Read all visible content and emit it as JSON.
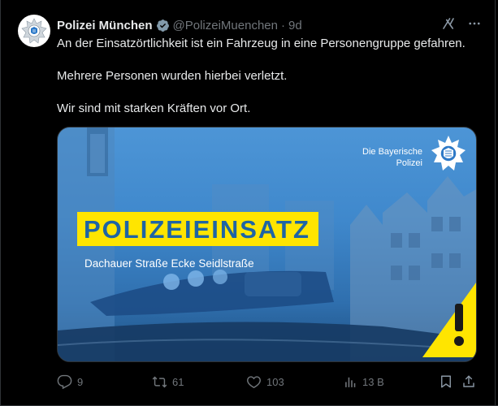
{
  "author": {
    "name": "Polizei München",
    "handle": "@PolizeiMuenchen",
    "separator": "·",
    "time": "9d"
  },
  "tweet": {
    "paragraphs": [
      "An der Einsatzörtlichkeit ist ein Fahrzeug in eine Personengruppe gefahren.",
      "Mehrere Personen wurden hierbei verletzt.",
      "Wir sind mit starken Kräften vor Ort."
    ]
  },
  "media": {
    "brand_line1": "Die Bayerische",
    "brand_line2": "Polizei",
    "banner": "POLIZEIEINSATZ",
    "location": "Dachauer Straße Ecke Seidlstraße"
  },
  "actions": {
    "replies": "9",
    "reposts": "61",
    "likes": "103",
    "views": "13 В"
  },
  "colors": {
    "background": "#000000",
    "text": "#e7e9ea",
    "muted": "#71767b",
    "verified_badge": "#829aab",
    "banner_yellow": "#ffe500",
    "banner_text": "#1e64a5"
  },
  "icons": {
    "verified": "verified-badge-icon",
    "grok": "grok-icon",
    "more": "more-icon",
    "reply": "reply-icon",
    "repost": "repost-icon",
    "like": "like-icon",
    "views": "views-icon",
    "bookmark": "bookmark-icon",
    "share": "share-icon"
  }
}
